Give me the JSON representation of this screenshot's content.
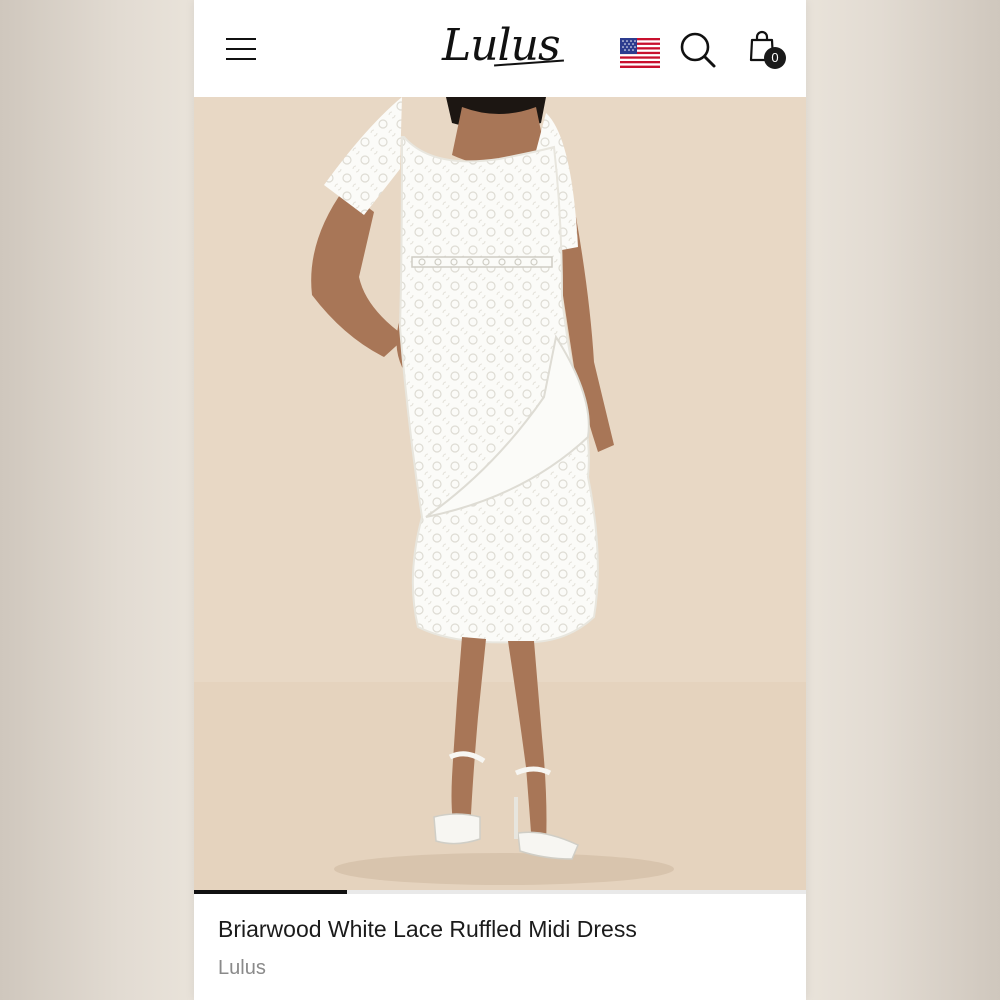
{
  "header": {
    "logo_text": "Lulus",
    "cart_count": "0",
    "icons": {
      "menu": "hamburger-menu-icon",
      "flag": "us-flag-icon",
      "search": "search-icon",
      "cart": "shopping-bag-icon"
    }
  },
  "gallery": {
    "image_alt": "Model wearing a white lace ruffled midi dress with white heeled sandals",
    "image_progress": 0.25
  },
  "product": {
    "name": "Briarwood White Lace Ruffled Midi Dress",
    "brand": "Lulus"
  },
  "colors": {
    "backdrop": "#e8d8c5",
    "dress": "#fbfbf8",
    "skin": "#a87657",
    "text_primary": "#1b1b1b",
    "text_secondary": "#8a8a8a"
  }
}
